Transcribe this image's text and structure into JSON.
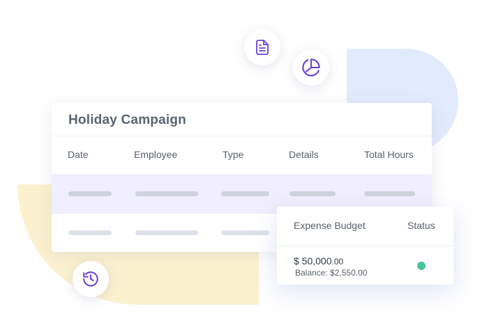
{
  "card": {
    "title": "Holiday Campaign",
    "columns": [
      "Date",
      "Employee",
      "Type",
      "Details",
      "Total Hours"
    ]
  },
  "budget_card": {
    "headers": [
      "Expense Budget",
      "Status"
    ],
    "amount_main": "$ 50,000",
    "amount_cents": ".00",
    "balance": "Balance: $2,550.00",
    "status_color": "#47c594"
  },
  "icons": [
    "document-icon",
    "pie-chart-icon",
    "history-icon"
  ],
  "colors": {
    "accent": "#6a3fd8",
    "highlight_row": "#f1eefd",
    "blob_blue": "#e2eafd",
    "blob_yellow": "#fbf1cf"
  }
}
